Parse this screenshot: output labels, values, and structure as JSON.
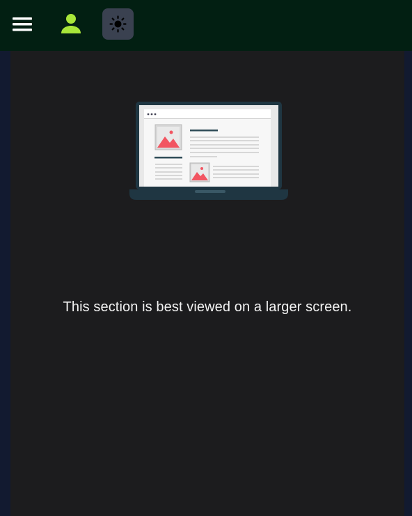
{
  "topbar": {
    "menu_icon": "hamburger-menu-icon",
    "user_icon": "user-icon",
    "theme_icon": "sun-icon",
    "colors": {
      "background": "#021f12",
      "user_accent": "#a8e63a",
      "theme_button_bg": "#3a4150"
    }
  },
  "main": {
    "illustration_icon": "laptop-illustration",
    "message": "This section is best viewed on a larger screen.",
    "colors": {
      "background": "#1c1c1e",
      "text": "#f2f2f2",
      "accent": "#f25561"
    }
  }
}
